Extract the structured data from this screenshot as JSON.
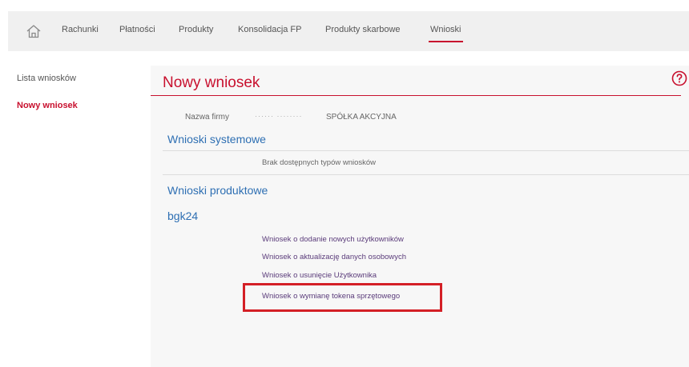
{
  "nav": {
    "items": [
      {
        "label": "Rachunki"
      },
      {
        "label": "Płatności"
      },
      {
        "label": "Produkty"
      },
      {
        "label": "Konsolidacja FP"
      },
      {
        "label": "Produkty skarbowe"
      },
      {
        "label": "Wnioski",
        "active": true
      }
    ]
  },
  "sidebar": {
    "items": [
      {
        "label": "Lista wniosków"
      },
      {
        "label": "Nowy wniosek",
        "active": true
      }
    ]
  },
  "main": {
    "title": "Nowy wniosek",
    "company_label": "Nazwa firmy",
    "company_redacted": "······ ········",
    "company_suffix": "SPÓŁKA AKCYJNA",
    "system_section": "Wnioski systemowe",
    "system_empty": "Brak dostępnych typów wniosków",
    "product_section": "Wnioski produktowe",
    "product_group": "bgk24",
    "applications": [
      {
        "label": "Wniosek o dodanie nowych użytkowników"
      },
      {
        "label": "Wniosek o aktualizację danych osobowych"
      },
      {
        "label": "Wniosek o usunięcie Użytkownika"
      },
      {
        "label": "Wniosek o wymianę tokena sprzętowego",
        "highlighted": true
      }
    ]
  },
  "colors": {
    "accent": "#c8102e",
    "section_heading": "#2e6fb3",
    "link": "#5a3b7a",
    "highlight_border": "#d41f26",
    "nav_background": "#f0f0f0",
    "content_background": "#f7f7f7"
  },
  "icons": {
    "home": "home-icon",
    "help": "help-circle-icon"
  }
}
